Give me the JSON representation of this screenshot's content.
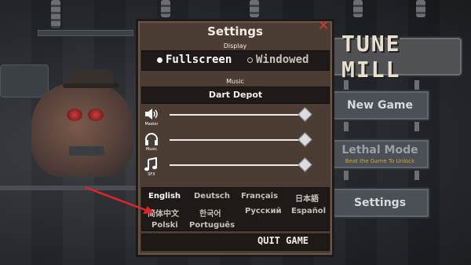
{
  "game": {
    "title": "TUNE MILL"
  },
  "menu": {
    "new_game": "New Game",
    "lethal_mode": "Lethal Mode",
    "lethal_mode_sub": "Beat the Game To Unlock",
    "settings": "Settings"
  },
  "settings": {
    "title": "Settings",
    "close": "✕",
    "display_label": "Display",
    "display_options": [
      "Fullscreen",
      "Windowed"
    ],
    "display_selected": "Fullscreen",
    "music_label": "Music",
    "music_track": "Dart Depot",
    "volumes": [
      {
        "label": "Master",
        "icon": "speaker-icon",
        "level": 0.96
      },
      {
        "label": "Music",
        "icon": "headphones-icon",
        "level": 0.96
      },
      {
        "label": "SFX",
        "icon": "music-note-icon",
        "level": 0.96
      }
    ],
    "languages": {
      "row1": [
        "English",
        "Deutsch",
        "Français",
        "日本語"
      ],
      "row2": [
        "简体中文",
        "한국어",
        "Русский",
        "Español"
      ],
      "row3": [
        "Polski",
        "Português"
      ],
      "selected": "English"
    },
    "quit": "QUIT GAME"
  },
  "colors": {
    "panel": "#4c3d34",
    "dark_bar": "#1f1a17",
    "close": "#d63a2e",
    "arrow": "#e0242b",
    "lethal_sub": "#d8a12a"
  }
}
